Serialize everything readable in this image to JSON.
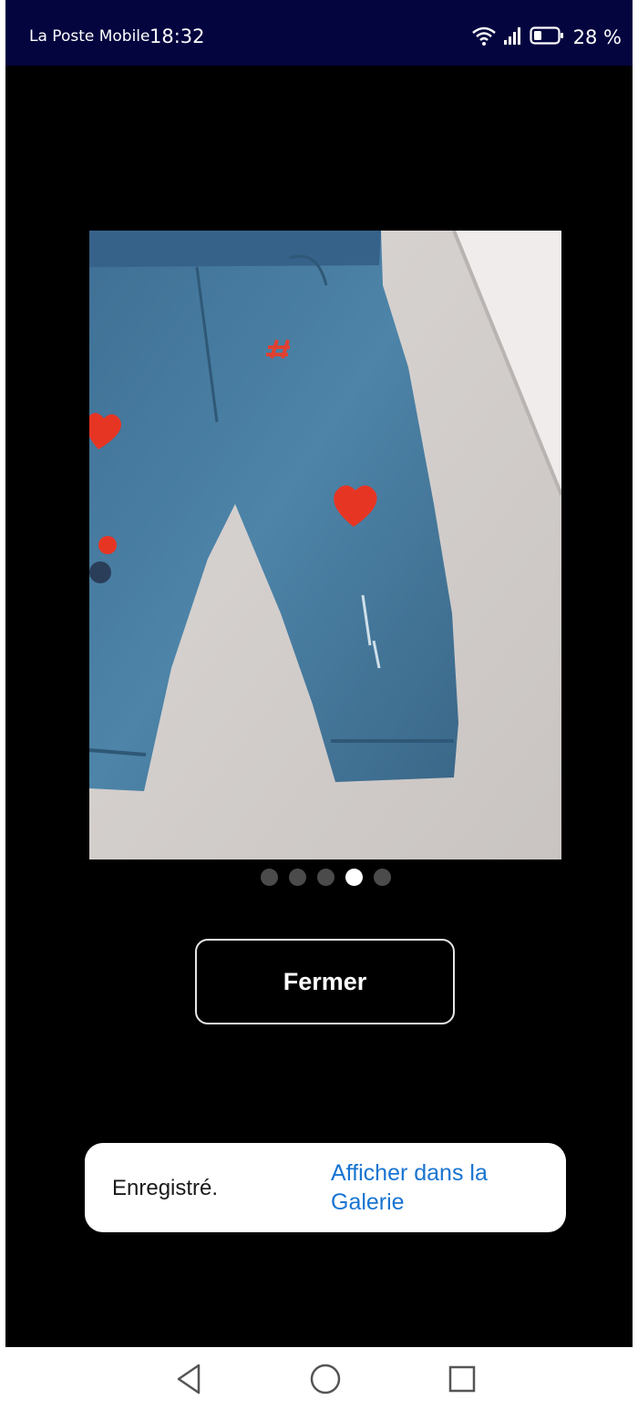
{
  "status_bar": {
    "carrier": "La Poste Mobile",
    "time": "18:32",
    "battery_percent": "28 %",
    "icons": [
      "wifi-icon",
      "signal-icon",
      "battery-icon"
    ]
  },
  "gallery": {
    "image_alt": "Jean bleu enfant avec cœurs rouges",
    "page_count": 5,
    "active_page": 4
  },
  "close_button": {
    "label": "Fermer"
  },
  "toast": {
    "message": "Enregistré.",
    "action": "Afficher dans la Galerie"
  },
  "nav_bar": {
    "buttons": [
      "back-icon",
      "home-icon",
      "recents-icon"
    ]
  },
  "colors": {
    "status_bar_bg": "#04043f",
    "screen_bg": "#000000",
    "toast_action": "#1874d1",
    "dot_active": "#ffffff",
    "dot_inactive": "#4b4b4b"
  }
}
